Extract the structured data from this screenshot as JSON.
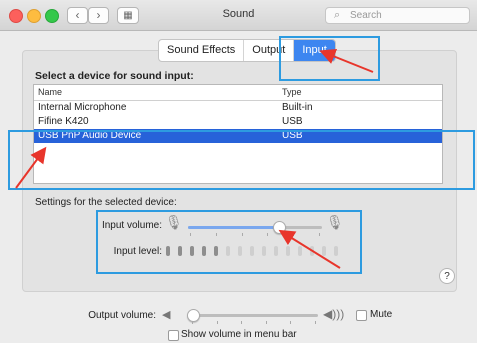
{
  "window": {
    "title": "Sound"
  },
  "toolbar": {
    "back_glyph": "‹",
    "forward_glyph": "›",
    "grid_glyph": "▦"
  },
  "search": {
    "placeholder": "Search",
    "icon": "magnifier-icon"
  },
  "tabs": [
    {
      "label": "Sound Effects",
      "selected": false
    },
    {
      "label": "Output",
      "selected": false
    },
    {
      "label": "Input",
      "selected": true
    }
  ],
  "input_section": {
    "title": "Select a device for sound input:",
    "columns": [
      "Name",
      "Type"
    ],
    "devices": [
      {
        "name": "Internal Microphone",
        "type": "Built-in",
        "selected": false
      },
      {
        "name": "Fifine K420",
        "type": "USB",
        "selected": false
      },
      {
        "name": "USB PnP Audio Device",
        "type": "USB",
        "selected": true
      }
    ]
  },
  "settings": {
    "label": "Settings for the selected device:",
    "input_volume_label": "Input volume:",
    "input_volume_value": 0.68,
    "input_level_label": "Input level:",
    "input_level_active": 5,
    "input_level_total": 15
  },
  "output": {
    "volume_label": "Output volume:",
    "volume_value": 0.02,
    "mute_label": "Mute",
    "mute_checked": false,
    "menubar_label": "Show volume in menu bar",
    "menubar_checked": false
  },
  "help_glyph": "?",
  "colors": {
    "accent": "#3d86f0",
    "selection": "#2762d9",
    "annotation_box": "#2d9be0",
    "annotation_arrow": "#e8352b"
  }
}
